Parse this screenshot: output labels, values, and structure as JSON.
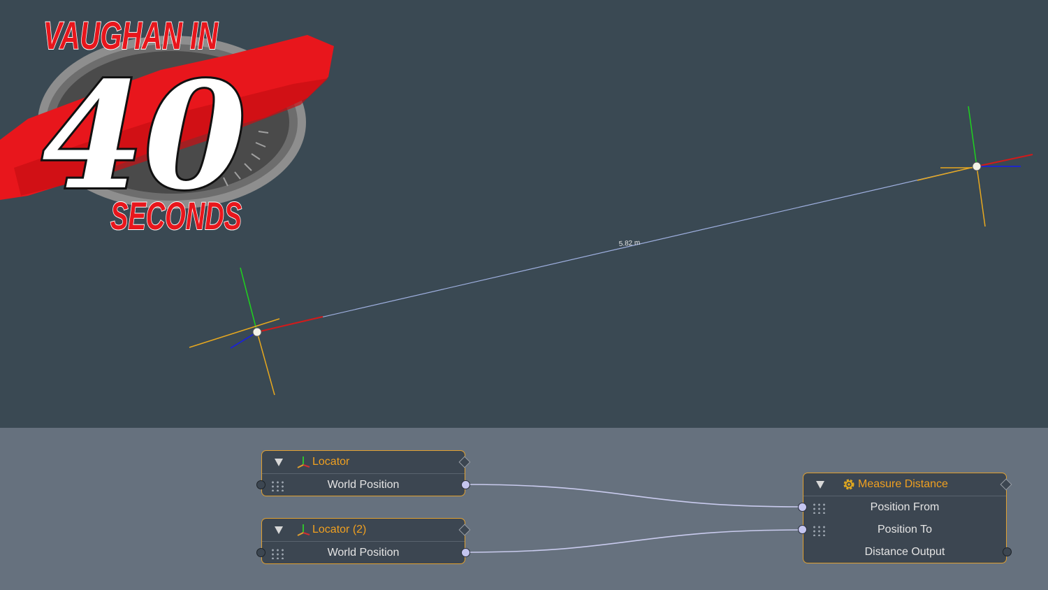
{
  "logo": {
    "line1": "VAUGHAN IN",
    "number": "40",
    "line2": "SECONDS"
  },
  "viewport": {
    "measurement_label": "5.82 m"
  },
  "schematic": {
    "nodes": [
      {
        "title": "Locator",
        "icon": "locator-axes-icon",
        "rows": [
          "World Position"
        ]
      },
      {
        "title": "Locator (2)",
        "icon": "locator-axes-icon",
        "rows": [
          "World Position"
        ]
      },
      {
        "title": "Measure Distance",
        "icon": "gear-icon",
        "rows": [
          "Position From",
          "Position To",
          "Distance Output"
        ]
      }
    ]
  },
  "colors": {
    "accent": "#f0a020",
    "viewport_bg": "#3a4953",
    "schematic_bg": "#66717e"
  }
}
